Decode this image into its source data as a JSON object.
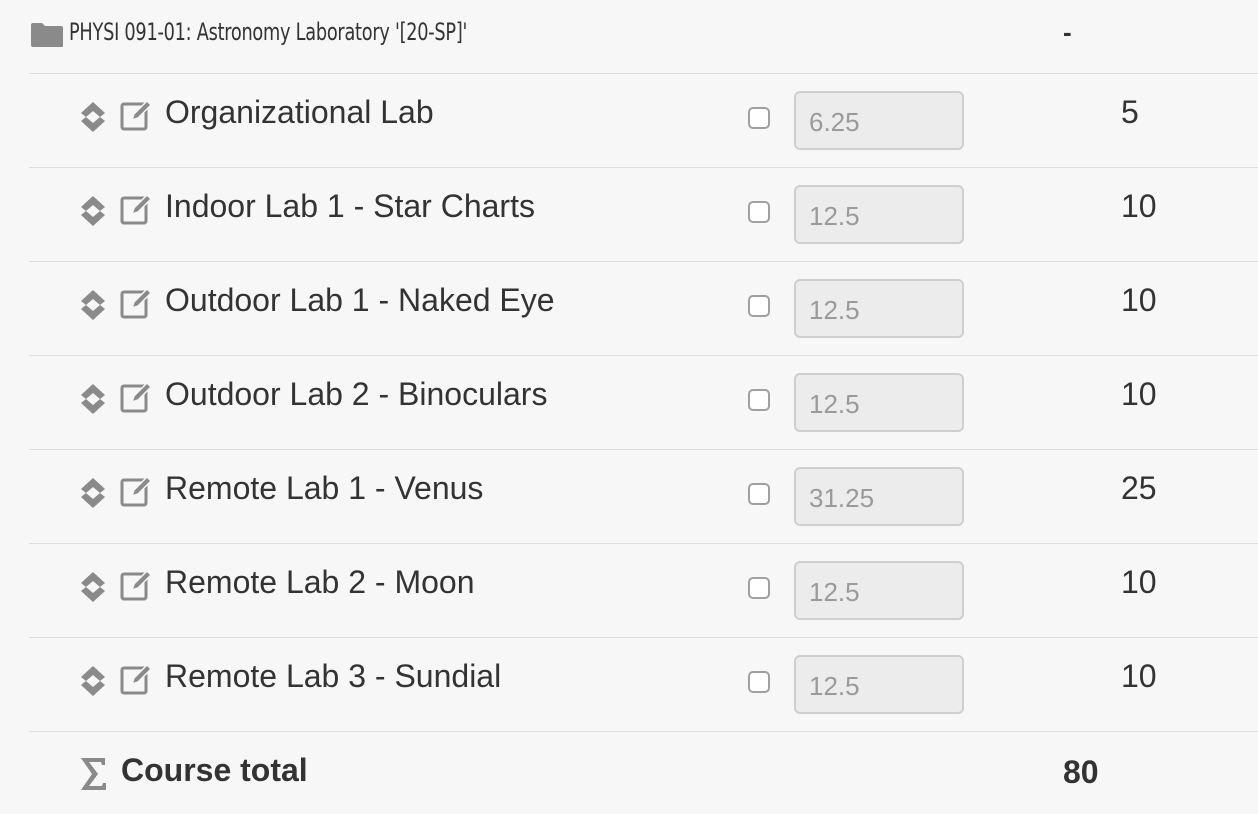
{
  "category": {
    "title": "PHYSI 091-01: Astronomy Laboratory '[20-SP]'",
    "total": "-"
  },
  "items": [
    {
      "name": "Organizational Lab",
      "weight": "6.25",
      "max_grade": "5"
    },
    {
      "name": "Indoor Lab 1 - Star Charts",
      "weight": "12.5",
      "max_grade": "10"
    },
    {
      "name": "Outdoor Lab 1 - Naked Eye",
      "weight": "12.5",
      "max_grade": "10"
    },
    {
      "name": "Outdoor Lab 2 - Binoculars",
      "weight": "12.5",
      "max_grade": "10"
    },
    {
      "name": "Remote Lab 1 - Venus",
      "weight": "31.25",
      "max_grade": "25"
    },
    {
      "name": "Remote Lab 2 - Moon",
      "weight": "12.5",
      "max_grade": "10"
    },
    {
      "name": "Remote Lab 3 - Sundial",
      "weight": "12.5",
      "max_grade": "10"
    }
  ],
  "course_total": {
    "label": "Course total",
    "value": "80"
  },
  "icons": {
    "category": "folder-icon",
    "move": "move-icon",
    "edit": "edit-icon",
    "total": "sigma-icon"
  },
  "colors": {
    "background": "#f7f7f7",
    "icon": "#8a8a8a",
    "text": "#333333",
    "input_bg": "#ececec",
    "input_text": "#9a9a9a"
  }
}
